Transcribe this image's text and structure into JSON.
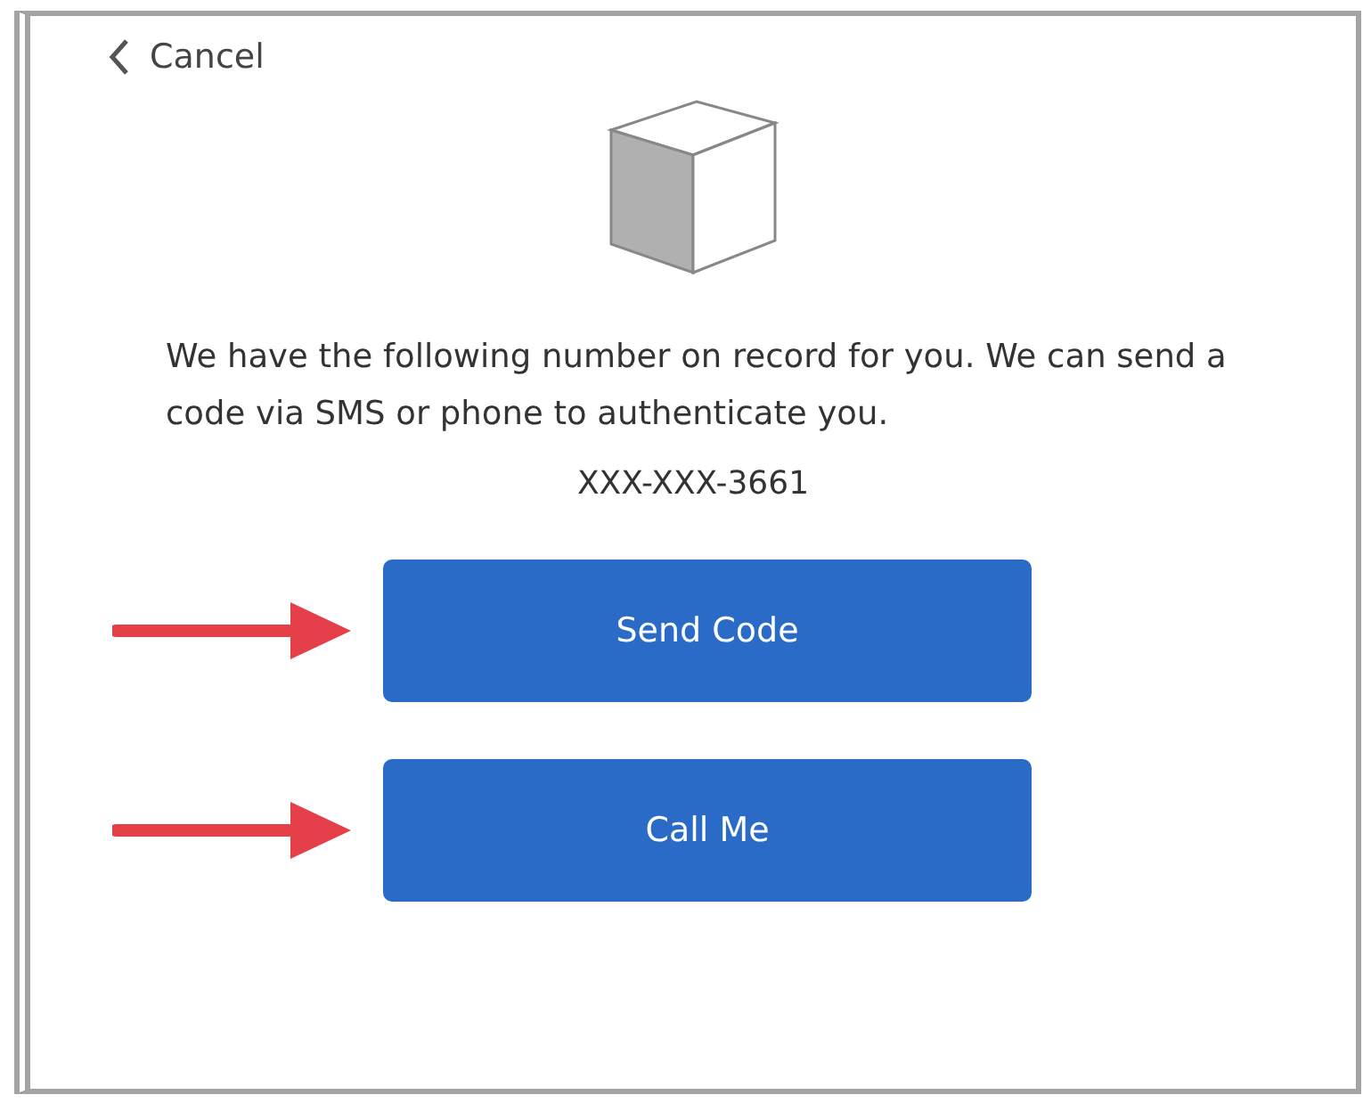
{
  "back_link": {
    "label": "Cancel"
  },
  "message": "We have the following number on record for you. We can send a code via SMS or phone to authenticate you.",
  "phone_number": "XXX-XXX-3661",
  "buttons": [
    {
      "label": "Send Code"
    },
    {
      "label": "Call Me"
    }
  ]
}
